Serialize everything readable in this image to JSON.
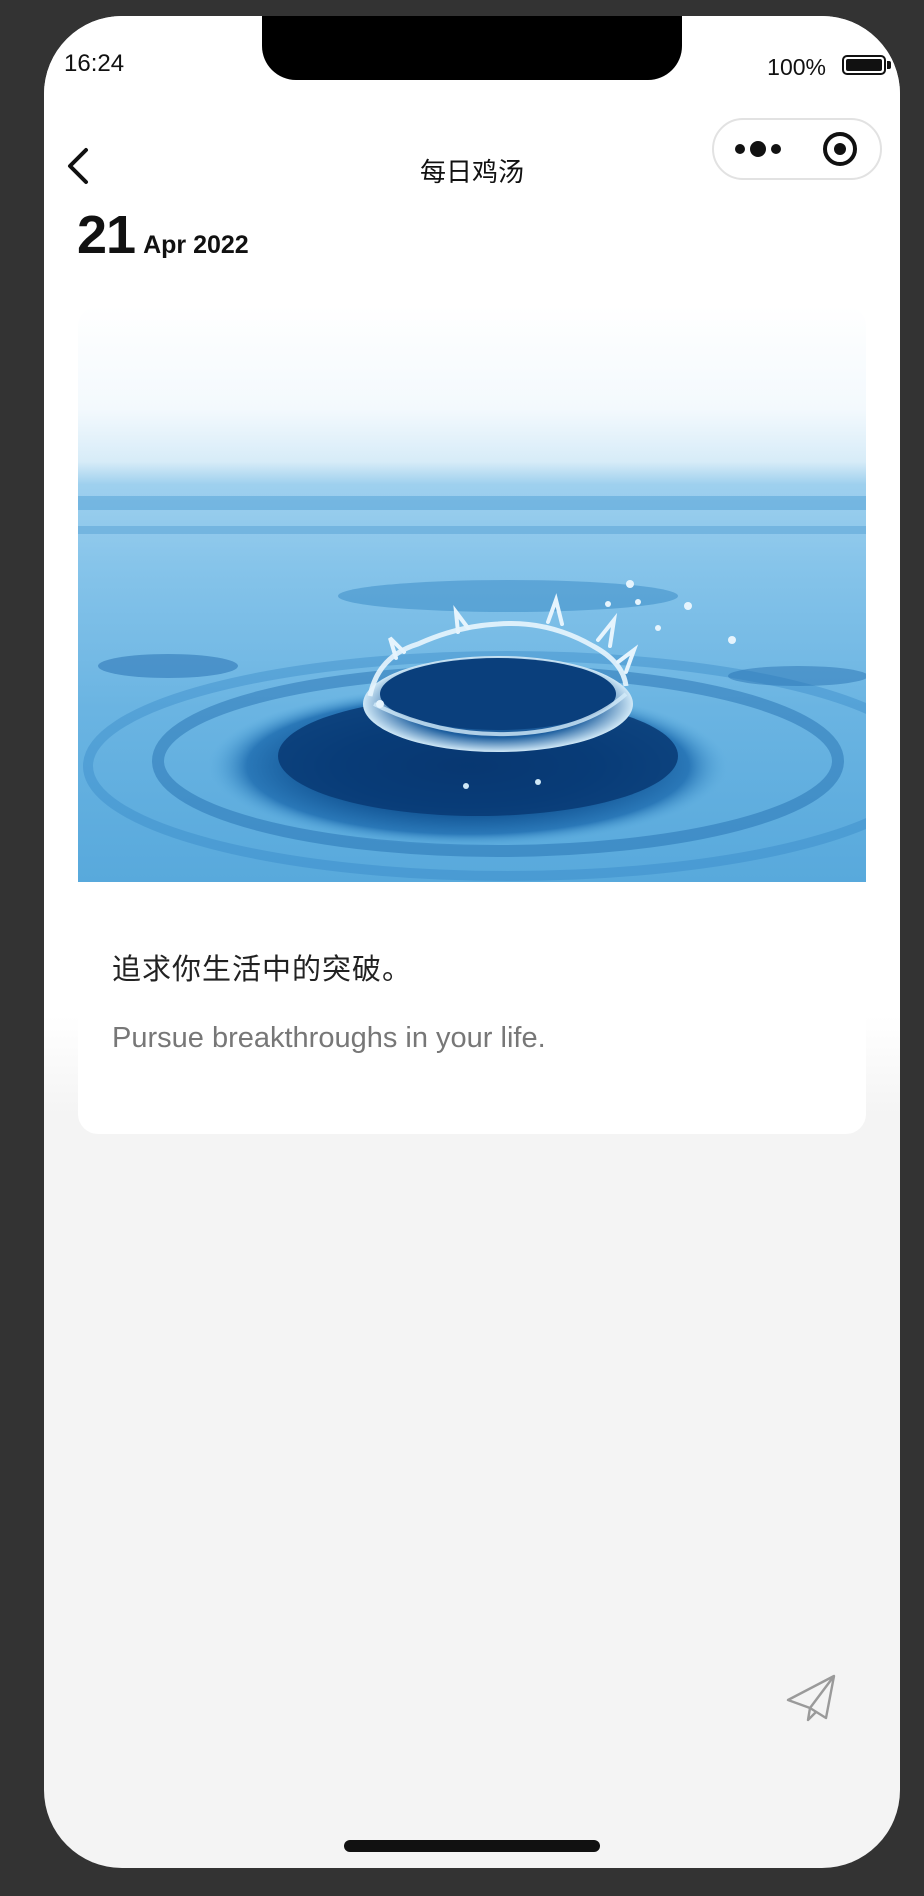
{
  "status_bar": {
    "time": "16:24",
    "battery": "100%"
  },
  "nav": {
    "title": "每日鸡汤",
    "icons": [
      "back-arrow-icon",
      "more-dots-icon",
      "target-circle-icon"
    ]
  },
  "date": {
    "day": "21",
    "month_year": "Apr 2022"
  },
  "card": {
    "image": "water-drop-splash",
    "quote_cn": "追求你生活中的突破。",
    "quote_en": "Pursue breakthroughs in your life."
  },
  "actions": {
    "share_icon": "paper-plane-icon"
  },
  "colors": {
    "background": "#f4f4f4",
    "card": "#ffffff",
    "text_primary": "#111111",
    "text_secondary": "#777777",
    "water_dark": "#0c4d8c",
    "water_light": "#7cc2ea"
  }
}
